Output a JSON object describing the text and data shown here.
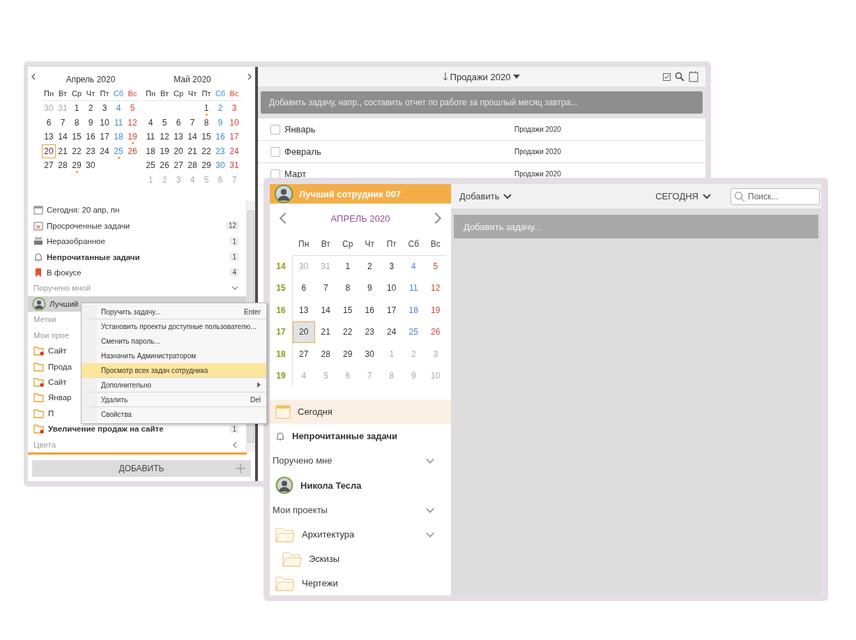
{
  "back_window": {
    "calendars": [
      {
        "title": "Апрель 2020",
        "weekdays": [
          "Пн",
          "Вт",
          "Ср",
          "Чт",
          "Пт",
          "Сб",
          "Вс"
        ],
        "weeks": [
          [
            {
              "day": "30",
              "muted": true,
              "dot": false,
              "selected": false
            },
            {
              "day": "31",
              "muted": true,
              "dot": false,
              "selected": false
            },
            {
              "day": "1",
              "muted": false,
              "dot": false,
              "selected": false
            },
            {
              "day": "2",
              "muted": false,
              "dot": false,
              "selected": false
            },
            {
              "day": "3",
              "muted": false,
              "dot": false,
              "selected": false
            },
            {
              "day": "4",
              "muted": false,
              "dot": false,
              "selected": false
            },
            {
              "day": "5",
              "muted": false,
              "dot": false,
              "selected": false
            }
          ],
          [
            {
              "day": "6",
              "muted": false,
              "dot": false,
              "selected": false
            },
            {
              "day": "7",
              "muted": false,
              "dot": false,
              "selected": false
            },
            {
              "day": "8",
              "muted": false,
              "dot": false,
              "selected": false
            },
            {
              "day": "9",
              "muted": false,
              "dot": false,
              "selected": false
            },
            {
              "day": "10",
              "muted": false,
              "dot": false,
              "selected": false
            },
            {
              "day": "11",
              "muted": false,
              "dot": false,
              "selected": false
            },
            {
              "day": "12",
              "muted": false,
              "dot": false,
              "selected": false
            }
          ],
          [
            {
              "day": "13",
              "muted": false,
              "dot": false,
              "selected": false
            },
            {
              "day": "14",
              "muted": false,
              "dot": false,
              "selected": false
            },
            {
              "day": "15",
              "muted": false,
              "dot": false,
              "selected": false
            },
            {
              "day": "16",
              "muted": false,
              "dot": false,
              "selected": false
            },
            {
              "day": "17",
              "muted": false,
              "dot": false,
              "selected": false
            },
            {
              "day": "18",
              "muted": false,
              "dot": false,
              "selected": false
            },
            {
              "day": "19",
              "muted": false,
              "dot": true,
              "selected": false
            }
          ],
          [
            {
              "day": "20",
              "muted": false,
              "dot": false,
              "selected": true
            },
            {
              "day": "21",
              "muted": false,
              "dot": false,
              "selected": false
            },
            {
              "day": "22",
              "muted": false,
              "dot": false,
              "selected": false
            },
            {
              "day": "23",
              "muted": false,
              "dot": false,
              "selected": false
            },
            {
              "day": "24",
              "muted": false,
              "dot": false,
              "selected": false
            },
            {
              "day": "25",
              "muted": false,
              "dot": true,
              "selected": false
            },
            {
              "day": "26",
              "muted": false,
              "dot": false,
              "selected": false
            }
          ],
          [
            {
              "day": "27",
              "muted": false,
              "dot": false,
              "selected": false
            },
            {
              "day": "28",
              "muted": false,
              "dot": false,
              "selected": false
            },
            {
              "day": "29",
              "muted": false,
              "dot": true,
              "selected": false
            },
            {
              "day": "30",
              "muted": false,
              "dot": false,
              "selected": false
            }
          ]
        ]
      },
      {
        "title": "Май 2020",
        "weekdays": [
          "Пн",
          "Вт",
          "Ср",
          "Чт",
          "Пт",
          "Сб",
          "Вс"
        ],
        "weeks": [
          [
            {
              "day": "1",
              "muted": false,
              "dot": true,
              "selected": false
            },
            {
              "day": "2",
              "muted": false,
              "dot": false,
              "selected": false
            },
            {
              "day": "3",
              "muted": false,
              "dot": false,
              "selected": false
            }
          ],
          [
            {
              "day": "4",
              "muted": false,
              "dot": false,
              "selected": false
            },
            {
              "day": "5",
              "muted": false,
              "dot": false,
              "selected": false
            },
            {
              "day": "6",
              "muted": false,
              "dot": false,
              "selected": false
            },
            {
              "day": "7",
              "muted": false,
              "dot": false,
              "selected": false
            },
            {
              "day": "8",
              "muted": false,
              "dot": false,
              "selected": false
            },
            {
              "day": "9",
              "muted": false,
              "dot": false,
              "selected": false
            },
            {
              "day": "10",
              "muted": false,
              "dot": false,
              "selected": false
            }
          ],
          [
            {
              "day": "11",
              "muted": false,
              "dot": false,
              "selected": false
            },
            {
              "day": "12",
              "muted": false,
              "dot": false,
              "selected": false
            },
            {
              "day": "13",
              "muted": false,
              "dot": false,
              "selected": false
            },
            {
              "day": "14",
              "muted": false,
              "dot": false,
              "selected": false
            },
            {
              "day": "15",
              "muted": false,
              "dot": false,
              "selected": false
            },
            {
              "day": "16",
              "muted": false,
              "dot": false,
              "selected": false
            },
            {
              "day": "17",
              "muted": false,
              "dot": false,
              "selected": false
            }
          ],
          [
            {
              "day": "18",
              "muted": false,
              "dot": false,
              "selected": false
            },
            {
              "day": "19",
              "muted": false,
              "dot": false,
              "selected": false
            },
            {
              "day": "20",
              "muted": false,
              "dot": false,
              "selected": false
            },
            {
              "day": "21",
              "muted": false,
              "dot": false,
              "selected": false
            },
            {
              "day": "22",
              "muted": false,
              "dot": false,
              "selected": false
            },
            {
              "day": "23",
              "muted": false,
              "dot": false,
              "selected": false
            },
            {
              "day": "24",
              "muted": false,
              "dot": false,
              "selected": false
            }
          ],
          [
            {
              "day": "25",
              "muted": false,
              "dot": false,
              "selected": false
            },
            {
              "day": "26",
              "muted": false,
              "dot": false,
              "selected": false
            },
            {
              "day": "27",
              "muted": false,
              "dot": false,
              "selected": false
            },
            {
              "day": "28",
              "muted": false,
              "dot": false,
              "selected": false
            },
            {
              "day": "29",
              "muted": false,
              "dot": false,
              "selected": false
            },
            {
              "day": "30",
              "muted": false,
              "dot": false,
              "selected": false
            },
            {
              "day": "31",
              "muted": false,
              "dot": false,
              "selected": false
            }
          ],
          [
            {
              "day": "1",
              "muted": true,
              "dot": false,
              "selected": false
            },
            {
              "day": "2",
              "muted": true,
              "dot": false,
              "selected": false
            },
            {
              "day": "3",
              "muted": true,
              "dot": false,
              "selected": false
            },
            {
              "day": "4",
              "muted": true,
              "dot": false,
              "selected": false
            },
            {
              "day": "5",
              "muted": true,
              "dot": false,
              "selected": false
            },
            {
              "day": "6",
              "muted": true,
              "dot": false,
              "selected": false
            },
            {
              "day": "7",
              "muted": true,
              "dot": false,
              "selected": false
            }
          ]
        ]
      }
    ],
    "sidebar": [
      {
        "kind": "nav",
        "label": "Сегодня: 20 апр, пн",
        "bold": false,
        "selected": false
      },
      {
        "kind": "nav",
        "label": "Просроченные задачи",
        "count": "12",
        "bold": false,
        "selected": false
      },
      {
        "kind": "nav",
        "label": "Неразобранное",
        "count": "1",
        "bold": false,
        "selected": false
      },
      {
        "kind": "nav",
        "label": "Непрочитанные задачи",
        "count": "1",
        "bold": true,
        "selected": false
      },
      {
        "kind": "nav",
        "label": "В фокусе",
        "count": "4",
        "bold": false,
        "selected": false
      },
      {
        "kind": "section",
        "label": "Поручено мной",
        "expanded": true
      },
      {
        "kind": "user",
        "label": "Лучший",
        "bold": false,
        "selected": true
      },
      {
        "kind": "section",
        "label": "Метки"
      },
      {
        "kind": "section",
        "label": "Мои прое"
      },
      {
        "kind": "project",
        "shared": true,
        "label": "Сайт",
        "bold": false,
        "selected": false
      },
      {
        "kind": "project",
        "shared": false,
        "label": "Прода",
        "bold": false,
        "selected": false
      },
      {
        "kind": "project",
        "shared": true,
        "label": "Сайт",
        "bold": false,
        "selected": false
      },
      {
        "kind": "project",
        "shared": false,
        "label": "Январ",
        "bold": false,
        "selected": false
      },
      {
        "kind": "project",
        "shared": false,
        "label": "П",
        "bold": false,
        "selected": false
      },
      {
        "kind": "project",
        "shared": true,
        "label": "Увеличение продаж на сайте",
        "count": "1",
        "bold": true,
        "selected": false
      },
      {
        "kind": "section",
        "label": "Цвета",
        "expanded": false
      }
    ],
    "add_button": "ДОБАВИТЬ",
    "toolbar": {
      "title": "Продажи 2020"
    },
    "task_input": {
      "placeholder": "Добавить задачу, напр., составить отчет по работе за прошлый месяц завтра..."
    },
    "tasks": [
      {
        "title": "Январь",
        "project": "Продажи 2020",
        "checked": false
      },
      {
        "title": "Февраль",
        "project": "Продажи 2020",
        "checked": false
      },
      {
        "title": "Март",
        "project": "Продажи 2020",
        "checked": false
      }
    ]
  },
  "context_menu": [
    {
      "label": "Поручить задачу...",
      "shortcut": "Enter",
      "selected": false,
      "submenu": false,
      "separator_after": true
    },
    {
      "label": "Установить проекты доступные пользователю...",
      "selected": false,
      "submenu": false,
      "separator_after": false
    },
    {
      "label": "Сменить пароль...",
      "selected": false,
      "submenu": false,
      "separator_after": false
    },
    {
      "label": "Назначить Администратором",
      "selected": false,
      "submenu": false,
      "separator_after": false
    },
    {
      "label": "Просмотр всех задач сотрудника",
      "selected": true,
      "submenu": false,
      "separator_after": true
    },
    {
      "label": "Дополнительно",
      "selected": false,
      "submenu": true,
      "separator_after": true
    },
    {
      "label": "Удалить",
      "shortcut": "Del",
      "selected": false,
      "submenu": false,
      "separator_after": true
    },
    {
      "label": "Свойства",
      "selected": false,
      "submenu": false,
      "separator_after": false
    }
  ],
  "front_window": {
    "user": "Лучший сотрудник 007",
    "calendar": {
      "title": "АПРЕЛЬ 2020",
      "weekdays": [
        "Пн",
        "Вт",
        "Ср",
        "Чт",
        "Пт",
        "Сб",
        "Вс"
      ],
      "weeks": [
        {
          "week": "14",
          "days": [
            {
              "day": "30",
              "muted": true,
              "selected": false
            },
            {
              "day": "31",
              "muted": true,
              "selected": false
            },
            {
              "day": "1",
              "muted": false,
              "selected": false
            },
            {
              "day": "2",
              "muted": false,
              "selected": false
            },
            {
              "day": "3",
              "muted": false,
              "selected": false
            },
            {
              "day": "4",
              "muted": false,
              "selected": false
            },
            {
              "day": "5",
              "muted": false,
              "selected": false
            }
          ]
        },
        {
          "week": "15",
          "days": [
            {
              "day": "6",
              "muted": false,
              "selected": false
            },
            {
              "day": "7",
              "muted": false,
              "selected": false
            },
            {
              "day": "8",
              "muted": false,
              "selected": false
            },
            {
              "day": "9",
              "muted": false,
              "selected": false
            },
            {
              "day": "10",
              "muted": false,
              "selected": false
            },
            {
              "day": "11",
              "muted": false,
              "selected": false
            },
            {
              "day": "12",
              "muted": false,
              "selected": false
            }
          ]
        },
        {
          "week": "16",
          "days": [
            {
              "day": "13",
              "muted": false,
              "selected": false
            },
            {
              "day": "14",
              "muted": false,
              "selected": false
            },
            {
              "day": "15",
              "muted": false,
              "selected": false
            },
            {
              "day": "16",
              "muted": false,
              "selected": false
            },
            {
              "day": "17",
              "muted": false,
              "selected": false
            },
            {
              "day": "18",
              "muted": false,
              "selected": false
            },
            {
              "day": "19",
              "muted": false,
              "selected": false
            }
          ]
        },
        {
          "week": "17",
          "days": [
            {
              "day": "20",
              "muted": false,
              "selected": true
            },
            {
              "day": "21",
              "muted": false,
              "selected": false
            },
            {
              "day": "22",
              "muted": false,
              "selected": false
            },
            {
              "day": "23",
              "muted": false,
              "selected": false
            },
            {
              "day": "24",
              "muted": false,
              "selected": false
            },
            {
              "day": "25",
              "muted": false,
              "selected": false
            },
            {
              "day": "26",
              "muted": false,
              "selected": false
            }
          ]
        },
        {
          "week": "18",
          "days": [
            {
              "day": "27",
              "muted": false,
              "selected": false
            },
            {
              "day": "28",
              "muted": false,
              "selected": false
            },
            {
              "day": "29",
              "muted": false,
              "selected": false
            },
            {
              "day": "30",
              "muted": false,
              "selected": false
            },
            {
              "day": "1",
              "muted": true,
              "selected": false
            },
            {
              "day": "2",
              "muted": true,
              "selected": false
            },
            {
              "day": "3",
              "muted": true,
              "selected": false
            }
          ]
        },
        {
          "week": "19",
          "days": [
            {
              "day": "4",
              "muted": true,
              "selected": false
            },
            {
              "day": "5",
              "muted": true,
              "selected": false
            },
            {
              "day": "6",
              "muted": true,
              "selected": false
            },
            {
              "day": "7",
              "muted": true,
              "selected": false
            },
            {
              "day": "8",
              "muted": true,
              "selected": false
            },
            {
              "day": "9",
              "muted": true,
              "selected": false
            },
            {
              "day": "10",
              "muted": true,
              "selected": false
            }
          ]
        }
      ]
    },
    "sidebar": [
      {
        "kind": "nav",
        "label": "Сегодня",
        "bold": false,
        "selected": true
      },
      {
        "kind": "nav",
        "label": "Непрочитанные задачи",
        "bold": true,
        "selected": false
      },
      {
        "kind": "section",
        "label": "Поручено мне",
        "expanded": true
      },
      {
        "kind": "user",
        "label": "Никола Тесла",
        "bold": true,
        "selected": false
      },
      {
        "kind": "section",
        "label": "Мои проекты",
        "expanded": true
      }
    ],
    "projects": [
      {
        "label": "Архитектура",
        "children": [
          {
            "label": "Эскизы"
          }
        ]
      },
      {
        "label": "Чертежи"
      }
    ],
    "add_menu": "Добавить",
    "today_menu": "СЕГОДНЯ",
    "search": {
      "placeholder": "Поиск..."
    },
    "task_input": {
      "placeholder": "Добавить задачу..."
    }
  }
}
